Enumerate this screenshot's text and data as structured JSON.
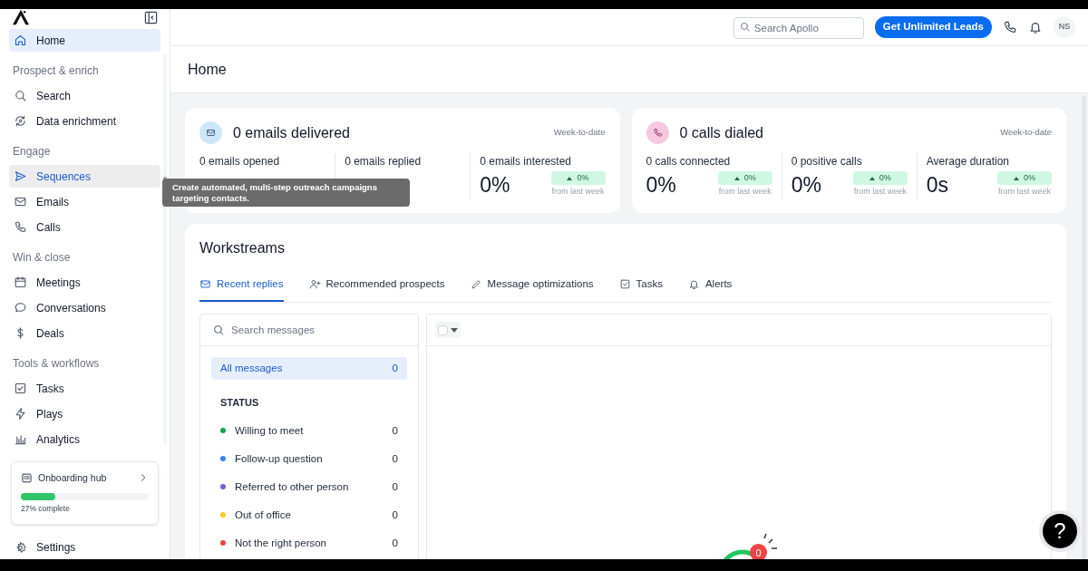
{
  "sidebar": {
    "nav": [
      {
        "kind": "item",
        "label": "Home",
        "selected": true,
        "hovered": false
      },
      {
        "kind": "heading",
        "label": "Prospect & enrich"
      },
      {
        "kind": "item",
        "label": "Search",
        "selected": false,
        "hovered": false
      },
      {
        "kind": "item",
        "label": "Data enrichment",
        "selected": false,
        "hovered": false
      },
      {
        "kind": "heading",
        "label": "Engage"
      },
      {
        "kind": "item",
        "label": "Sequences",
        "selected": false,
        "hovered": true
      },
      {
        "kind": "item",
        "label": "Emails",
        "selected": false,
        "hovered": false
      },
      {
        "kind": "item",
        "label": "Calls",
        "selected": false,
        "hovered": false
      },
      {
        "kind": "heading",
        "label": "Win & close"
      },
      {
        "kind": "item",
        "label": "Meetings",
        "selected": false,
        "hovered": false
      },
      {
        "kind": "item",
        "label": "Conversations",
        "selected": false,
        "hovered": false
      },
      {
        "kind": "item",
        "label": "Deals",
        "selected": false,
        "hovered": false
      },
      {
        "kind": "heading",
        "label": "Tools & workflows"
      },
      {
        "kind": "item",
        "label": "Tasks",
        "selected": false,
        "hovered": false
      },
      {
        "kind": "item",
        "label": "Plays",
        "selected": false,
        "hovered": false
      },
      {
        "kind": "item",
        "label": "Analytics",
        "selected": false,
        "hovered": false
      }
    ],
    "onboarding": {
      "title": "Onboarding hub",
      "level": 0.27,
      "caption": "27% complete"
    },
    "settings": "Settings"
  },
  "tooltip": "Create automated, multi-step outreach campaigns targeting contacts.",
  "header": {
    "search_placeholder": "Search Apollo",
    "cta": "Get Unlimited Leads",
    "avatar": "NS"
  },
  "page_title": "Home",
  "stat_cards": [
    {
      "title": "0 emails delivered",
      "period": "Week-to-date",
      "metrics": [
        {
          "label": "0 emails opened"
        },
        {
          "label": "0 emails replied"
        },
        {
          "label": "0 emails interested",
          "value": "0%",
          "change": "0%",
          "note": "from last week"
        }
      ]
    },
    {
      "title": "0 calls dialed",
      "period": "Week-to-date",
      "metrics": [
        {
          "label": "0 calls connected",
          "value": "0%",
          "change": "0%",
          "note": "from last week"
        },
        {
          "label": "0 positive calls",
          "value": "0%",
          "change": "0%",
          "note": "from last week"
        },
        {
          "label": "Average duration",
          "value": "0s",
          "change": "0%",
          "note": "from last week"
        }
      ]
    }
  ],
  "workstreams": {
    "title": "Workstreams",
    "tabs": [
      {
        "label": "Recent replies",
        "selected": true
      },
      {
        "label": "Recommended prospects",
        "selected": false
      },
      {
        "label": "Message optimizations",
        "selected": false
      },
      {
        "label": "Tasks",
        "selected": false
      },
      {
        "label": "Alerts",
        "selected": false
      }
    ],
    "search_placeholder": "Search messages",
    "folders": [
      {
        "label": "All messages",
        "count": "0",
        "selected": true
      }
    ],
    "status_heading": "STATUS",
    "statuses": [
      {
        "label": "Willing to meet",
        "count": "0",
        "color": "#16a34a"
      },
      {
        "label": "Follow-up question",
        "count": "0",
        "color": "#3b82f6"
      },
      {
        "label": "Referred to other person",
        "count": "0",
        "color": "#7c5ce0"
      },
      {
        "label": "Out of office",
        "count": "0",
        "color": "#facc15"
      },
      {
        "label": "Not the right person",
        "count": "0",
        "color": "#ef4444"
      }
    ],
    "select_all": {
      "checked": false
    },
    "illustration_badge": "0"
  },
  "help_button": "?"
}
